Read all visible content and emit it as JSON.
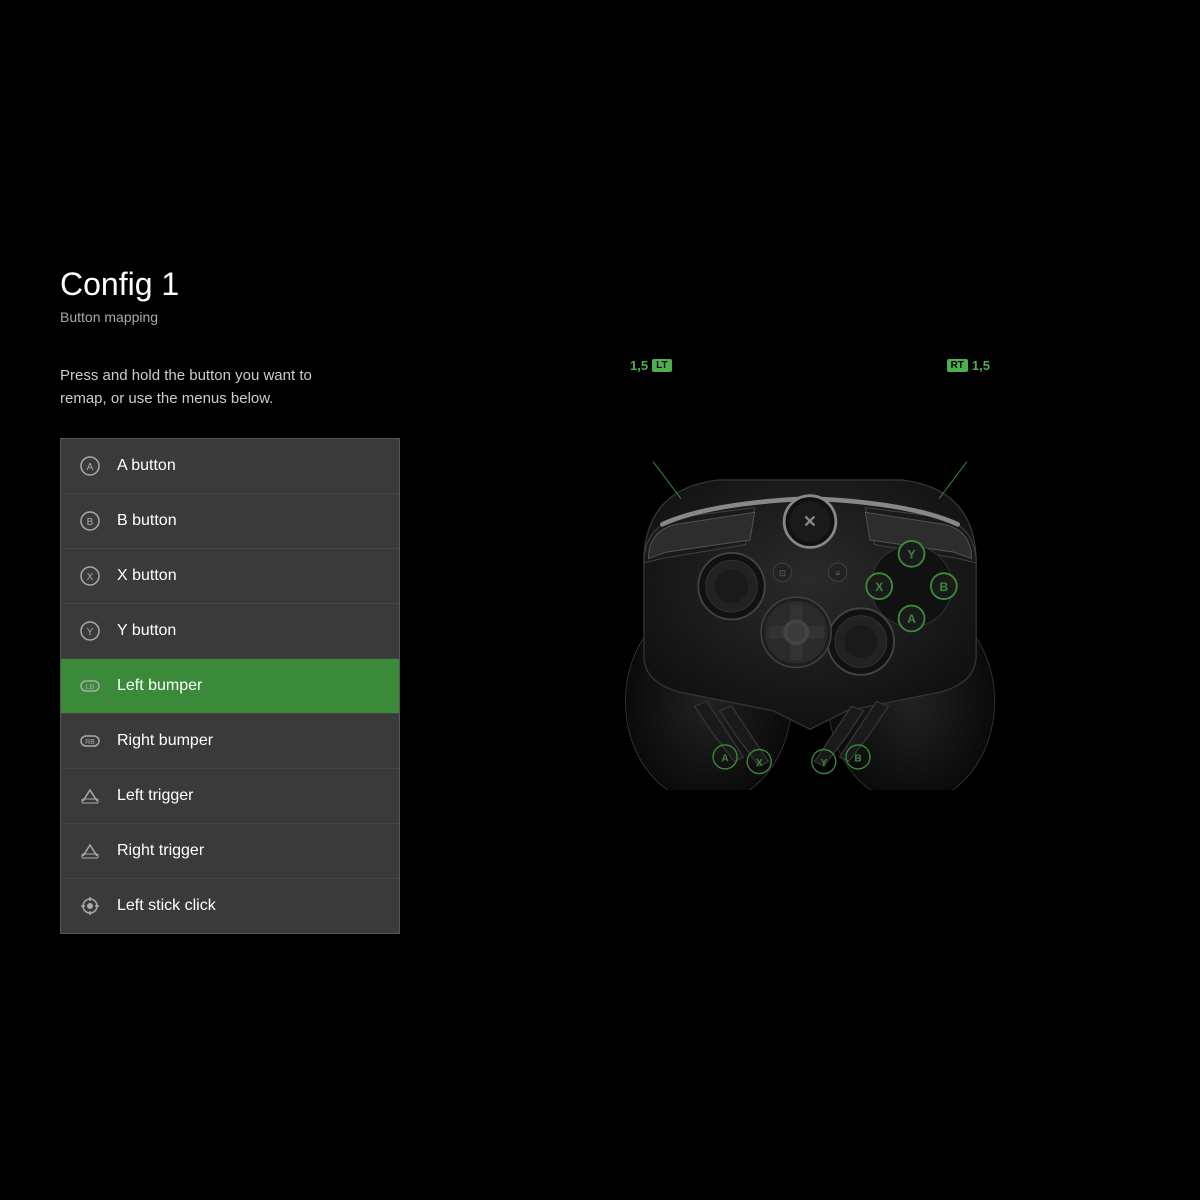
{
  "page": {
    "background": "#000000"
  },
  "header": {
    "title": "Config 1",
    "subtitle": "Button mapping"
  },
  "instructions": "Press and hold the button you want to remap, or use the menus below.",
  "button_list": {
    "items": [
      {
        "id": "a-button",
        "label": "A button",
        "icon": "a-icon",
        "active": false
      },
      {
        "id": "b-button",
        "label": "B button",
        "icon": "b-icon",
        "active": false
      },
      {
        "id": "x-button",
        "label": "X button",
        "icon": "x-icon",
        "active": false
      },
      {
        "id": "y-button",
        "label": "Y button",
        "icon": "y-icon",
        "active": false
      },
      {
        "id": "left-bumper",
        "label": "Left bumper",
        "icon": "lb-icon",
        "active": true
      },
      {
        "id": "right-bumper",
        "label": "Right bumper",
        "icon": "rb-icon",
        "active": false
      },
      {
        "id": "left-trigger",
        "label": "Left trigger",
        "icon": "lt-icon",
        "active": false
      },
      {
        "id": "right-trigger",
        "label": "Right trigger",
        "icon": "rt-icon",
        "active": false
      },
      {
        "id": "left-stick-click",
        "label": "Left stick click",
        "icon": "ls-icon",
        "active": false
      }
    ]
  },
  "controller": {
    "lt_label": "LT",
    "rt_label": "RT",
    "lt_value": "1,5",
    "rt_value": "1,5",
    "paddle_a": "A",
    "paddle_b": "B",
    "paddle_x": "X",
    "paddle_y": "Y"
  }
}
